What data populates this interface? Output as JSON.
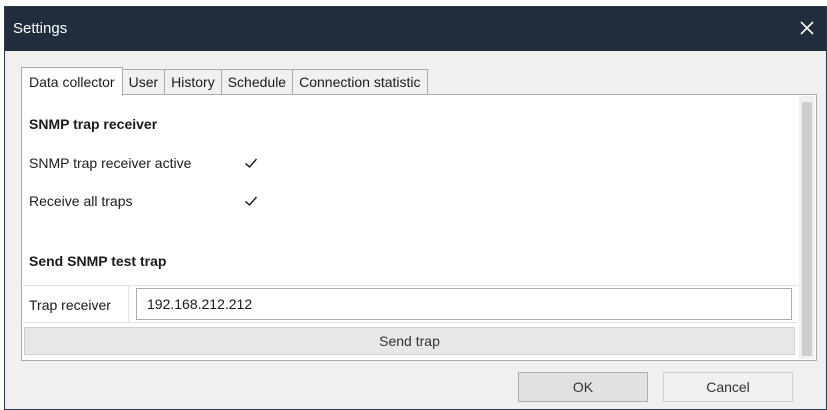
{
  "window": {
    "title": "Settings"
  },
  "tabs": [
    {
      "label": "Data collector",
      "active": true
    },
    {
      "label": "User",
      "active": false
    },
    {
      "label": "History",
      "active": false
    },
    {
      "label": "Schedule",
      "active": false
    },
    {
      "label": "Connection statistic",
      "active": false
    }
  ],
  "snmp_receiver": {
    "section_title": "SNMP trap receiver",
    "active_label": "SNMP trap receiver active",
    "active_checked": true,
    "receive_all_label": "Receive all traps",
    "receive_all_checked": true
  },
  "send_test": {
    "section_title": "Send SNMP test trap",
    "receiver_label": "Trap receiver",
    "receiver_value": "192.168.212.212",
    "send_button": "Send trap"
  },
  "footer": {
    "ok_label": "OK",
    "cancel_label": "Cancel"
  },
  "icons": {
    "close": "close-icon",
    "check": "checkmark-icon"
  },
  "colors": {
    "titlebar": "#1f2d3d",
    "panel": "#ffffff",
    "window": "#f0f0f0"
  }
}
